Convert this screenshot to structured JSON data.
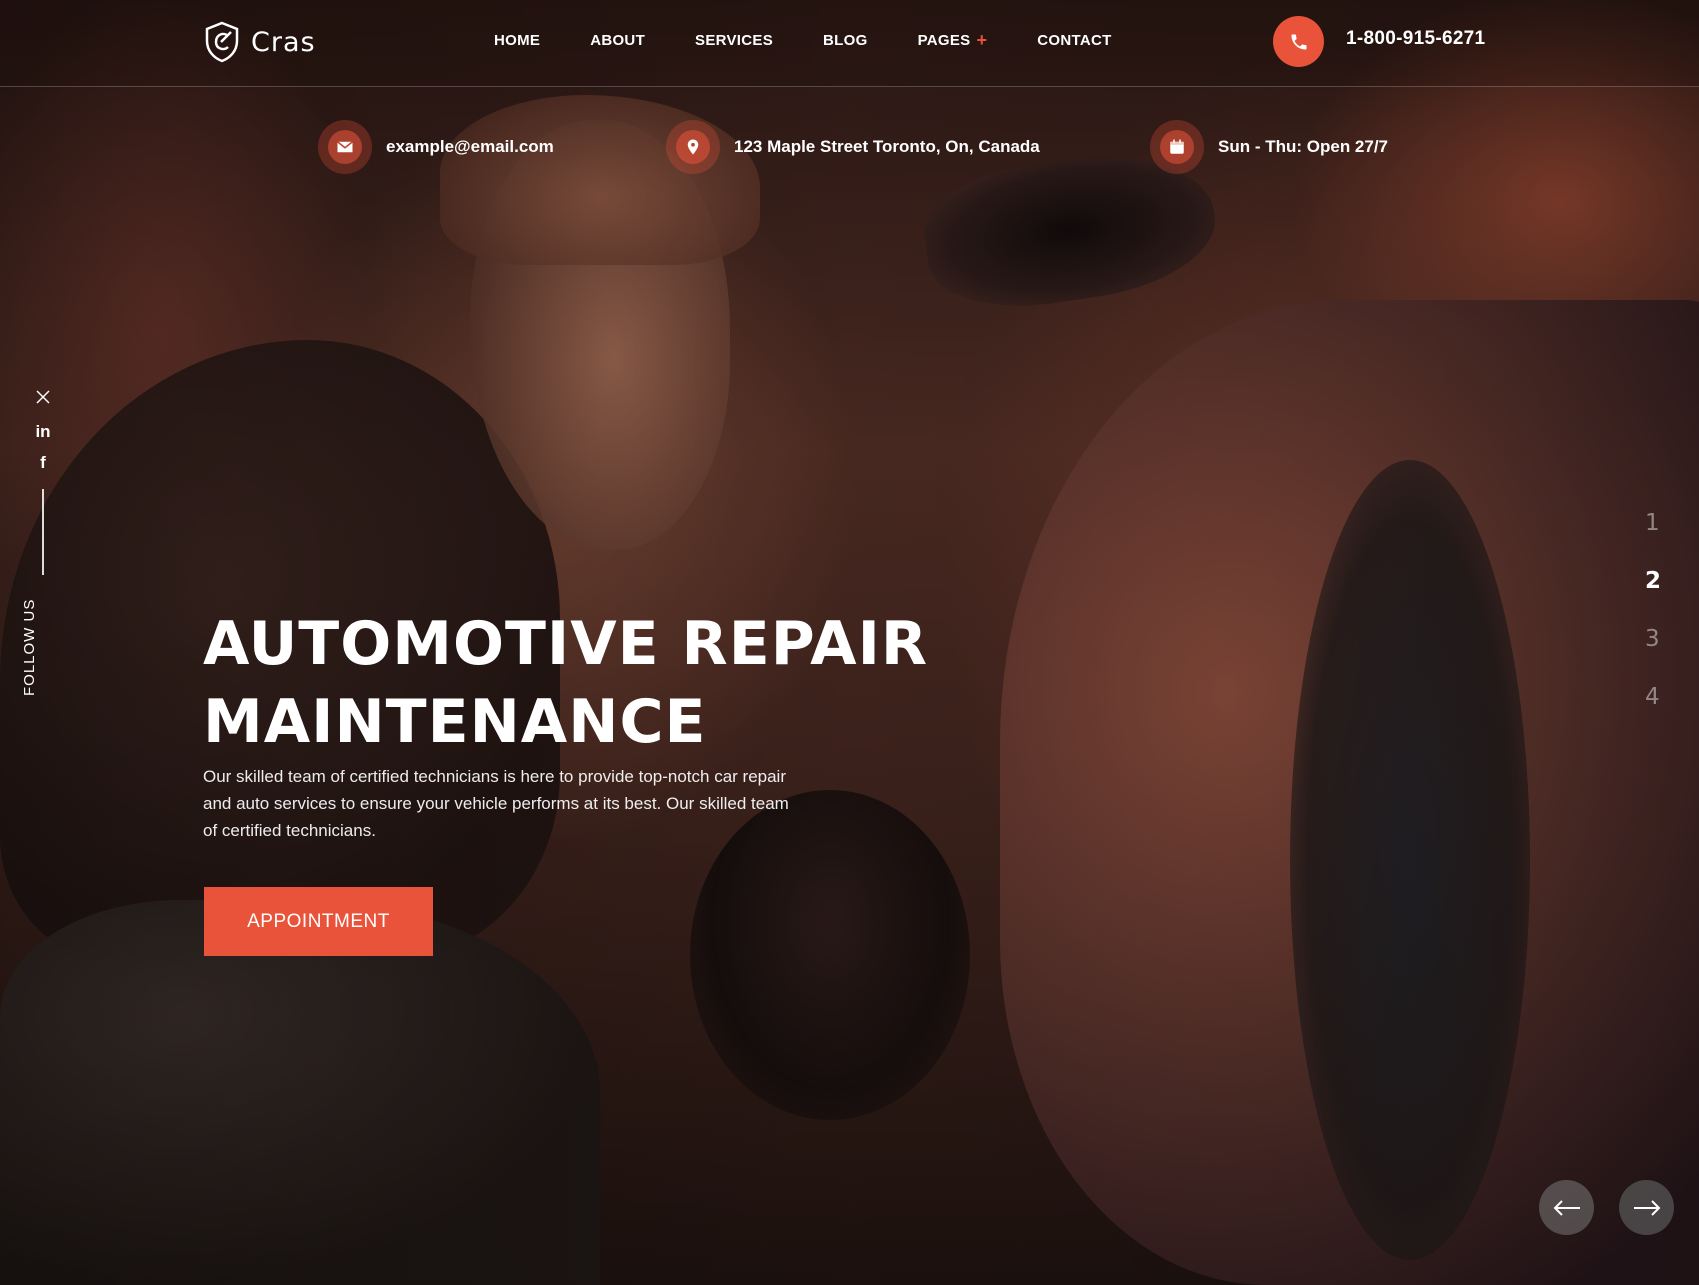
{
  "brand": {
    "name": "Cras",
    "accent_color": "#e8533a"
  },
  "nav": {
    "items": [
      {
        "label": "HOME"
      },
      {
        "label": "ABOUT"
      },
      {
        "label": "SERVICES"
      },
      {
        "label": "BLOG"
      },
      {
        "label": "PAGES",
        "submenu_indicator": "+"
      },
      {
        "label": "CONTACT"
      }
    ]
  },
  "header": {
    "phone_icon": "phone-icon",
    "phone_number": "1-800-915-6271"
  },
  "info_bar": {
    "email": {
      "icon": "envelope-icon",
      "text": "example@email.com"
    },
    "address": {
      "icon": "map-pin-icon",
      "text": "123 Maple Street Toronto, On, Canada"
    },
    "hours": {
      "icon": "calendar-icon",
      "text": "Sun - Thu: Open 27/7"
    }
  },
  "social": {
    "label": "FOLLOW US",
    "icons": [
      {
        "name": "x-icon",
        "glyph": "✕"
      },
      {
        "name": "linkedin-icon",
        "glyph": "in"
      },
      {
        "name": "facebook-icon",
        "glyph": "f"
      }
    ]
  },
  "slider": {
    "numbers": [
      "1",
      "2",
      "3",
      "4"
    ],
    "active_index": 1,
    "prev_icon": "arrow-left-icon",
    "next_icon": "arrow-right-icon"
  },
  "hero": {
    "title_line1": "AUTOMOTIVE REPAIR",
    "title_line2": "MAINTENANCE",
    "description": "Our skilled team of certified technicians is here to provide top-notch car repair and auto services to ensure your vehicle performs at its best. Our skilled team of certified technicians.",
    "cta_label": "APPOINTMENT"
  }
}
